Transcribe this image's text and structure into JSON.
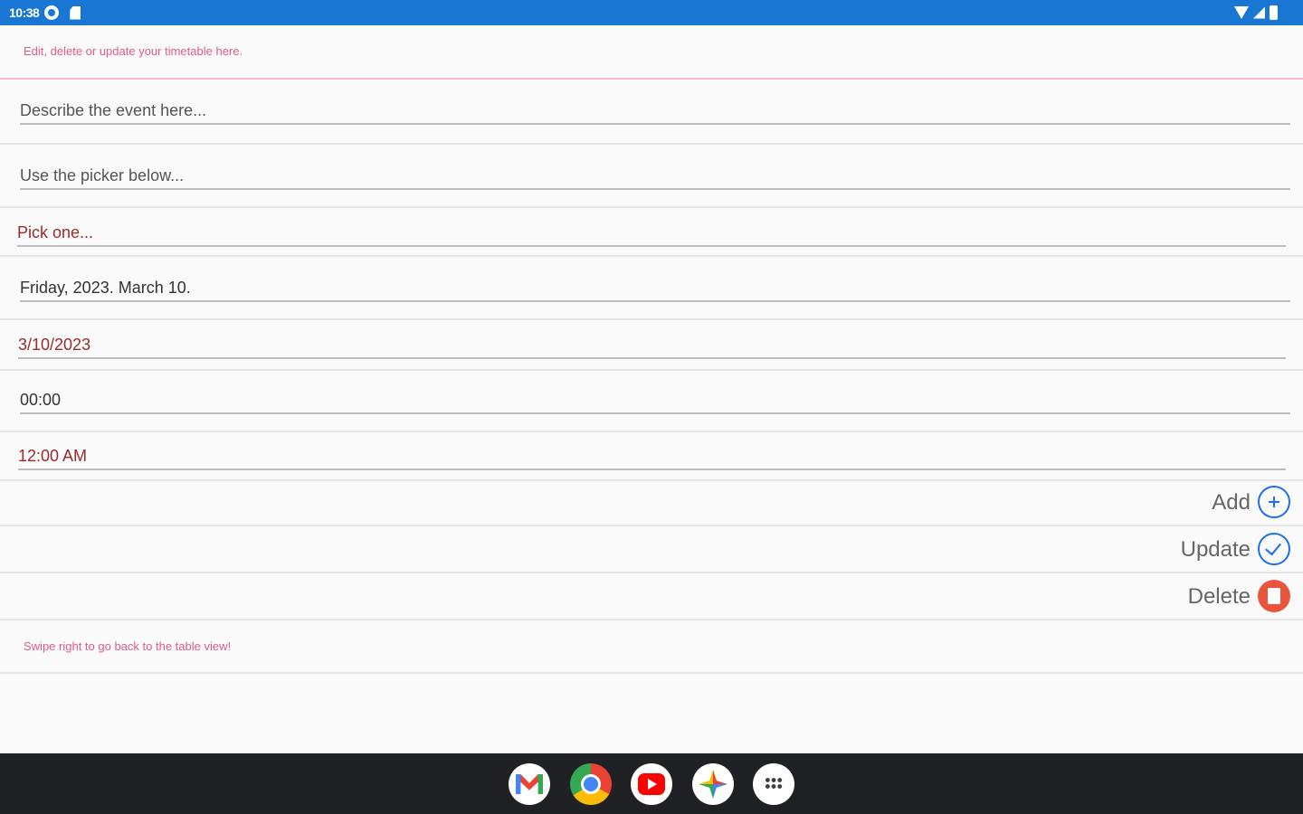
{
  "status_bar": {
    "time": "10:38",
    "icons": [
      "settings-icon",
      "sd-card-icon",
      "wifi-icon",
      "signal-icon",
      "battery-icon"
    ]
  },
  "header": {
    "caption": "Edit, delete or update your timetable here."
  },
  "form": {
    "description": {
      "placeholder": "Describe the event here..."
    },
    "picker_hint": {
      "placeholder": "Use the picker below..."
    },
    "pick_one": {
      "value": "Pick one..."
    },
    "date_long": {
      "value": "Friday, 2023. March 10."
    },
    "date_short": {
      "value": "3/10/2023"
    },
    "time_24": {
      "value": "00:00"
    },
    "time_12": {
      "value": "12:00 AM"
    }
  },
  "actions": {
    "add": {
      "label": "Add",
      "icon": "add-circle-icon"
    },
    "update": {
      "label": "Update",
      "icon": "check-circle-icon"
    },
    "delete": {
      "label": "Delete",
      "icon": "trash-icon"
    }
  },
  "footer": {
    "caption": "Swipe right to go back to the table view!"
  },
  "dock": {
    "apps": [
      "gmail-icon",
      "chrome-icon",
      "youtube-icon",
      "photos-icon",
      "app-launcher-icon"
    ]
  },
  "colors": {
    "status_bar": "#1976d2",
    "accent_pink": "#e05a8a",
    "picker_text": "#9a2b2b",
    "action_blue": "#1e6ef2",
    "delete_red": "#e8553e",
    "taskbar": "#202124"
  }
}
